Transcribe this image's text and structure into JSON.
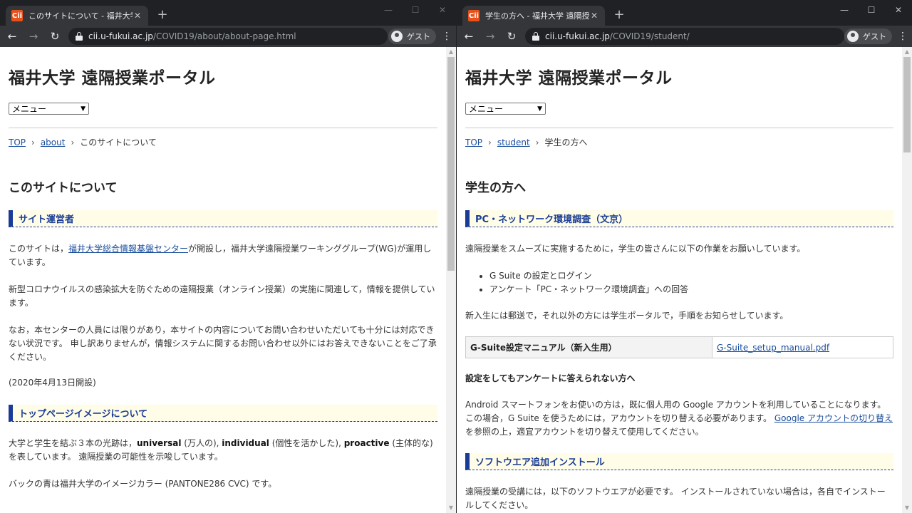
{
  "left": {
    "tab": {
      "title": "このサイトについて - 福井大学 遠隔授業ポータル",
      "favicon": "Cii"
    },
    "url": {
      "host": "cii.u-fukui.ac.jp",
      "path": "/COVID19/about/about-page.html"
    },
    "profile": "ゲスト",
    "site_title": "福井大学 遠隔授業ポータル",
    "menu_value": "メニュー",
    "breadcrumb": {
      "top": "TOP",
      "mid": "about",
      "current": "このサイトについて"
    },
    "page_title": "このサイトについて",
    "sec1": {
      "heading": "サイト運営者",
      "p1_a": "このサイトは，",
      "p1_link": "福井大学総合情報基盤センター",
      "p1_b": "が開設し，福井大学遠隔授業ワーキンググループ(WG)が運用しています。",
      "p2": "新型コロナウイルスの感染拡大を防ぐための遠隔授業（オンライン授業）の実施に関連して，情報を提供しています。",
      "p3": "なお，本センターの人員には限りがあり，本サイトの内容についてお問い合わせいただいても十分には対応できない状況です。 申し訳ありませんが，情報システムに関するお問い合わせ以外にはお答えできないことをご了承ください。",
      "p4": "(2020年4月13日開設)"
    },
    "sec2": {
      "heading": "トップページイメージについて",
      "p1_a": "大学と学生を結ぶ３本の光跡は，",
      "p1_b1": "universal",
      "p1_c": " (万人の), ",
      "p1_b2": "individual",
      "p1_d": " (個性を活かした), ",
      "p1_b3": "proactive",
      "p1_e": " (主体的な) を表しています。 遠隔授業の可能性を示唆しています。",
      "p2": "バックの青は福井大学のイメージカラー (PANTONE286 CVC) です。"
    }
  },
  "right": {
    "tab": {
      "title": "学生の方へ - 福井大学 遠隔授業ポータル",
      "favicon": "Cii"
    },
    "url": {
      "host": "cii.u-fukui.ac.jp",
      "path": "/COVID19/student/"
    },
    "profile": "ゲスト",
    "site_title": "福井大学 遠隔授業ポータル",
    "menu_value": "メニュー",
    "breadcrumb": {
      "top": "TOP",
      "mid": "student",
      "current": "学生の方へ"
    },
    "page_title": "学生の方へ",
    "sec1": {
      "heading": "PC・ネットワーク環境調査（文京）",
      "p1": "遠隔授業をスムーズに実施するために，学生の皆さんに以下の作業をお願いしています。",
      "bullets": [
        "G Suite の設定とログイン",
        "アンケート「PC・ネットワーク環境調査」への回答"
      ],
      "p2": "新入生には郵送で，それ以外の方には学生ポータルで，手順をお知らせしています。",
      "table": {
        "label": "G-Suite設定マニュアル（新入生用）",
        "link": "G-Suite_setup_manual.pdf"
      },
      "h4": "設定をしてもアンケートに答えられない方へ",
      "p3_a": "Android スマートフォンをお使いの方は，既に個人用の Google アカウントを利用していることになります。 この場合，G Suite を使うためには，アカウントを切り替える必要があります。 ",
      "p3_link": "Google アカウントの切り替え",
      "p3_b": " を参照の上，適宜アカウントを切り替えて使用してください。"
    },
    "sec2": {
      "heading": "ソフトウエア追加インストール",
      "p1": "遠隔授業の受講には，以下のソフトウエアが必要です。 インストールされていない場合は，各自でインストールしてください。"
    }
  }
}
